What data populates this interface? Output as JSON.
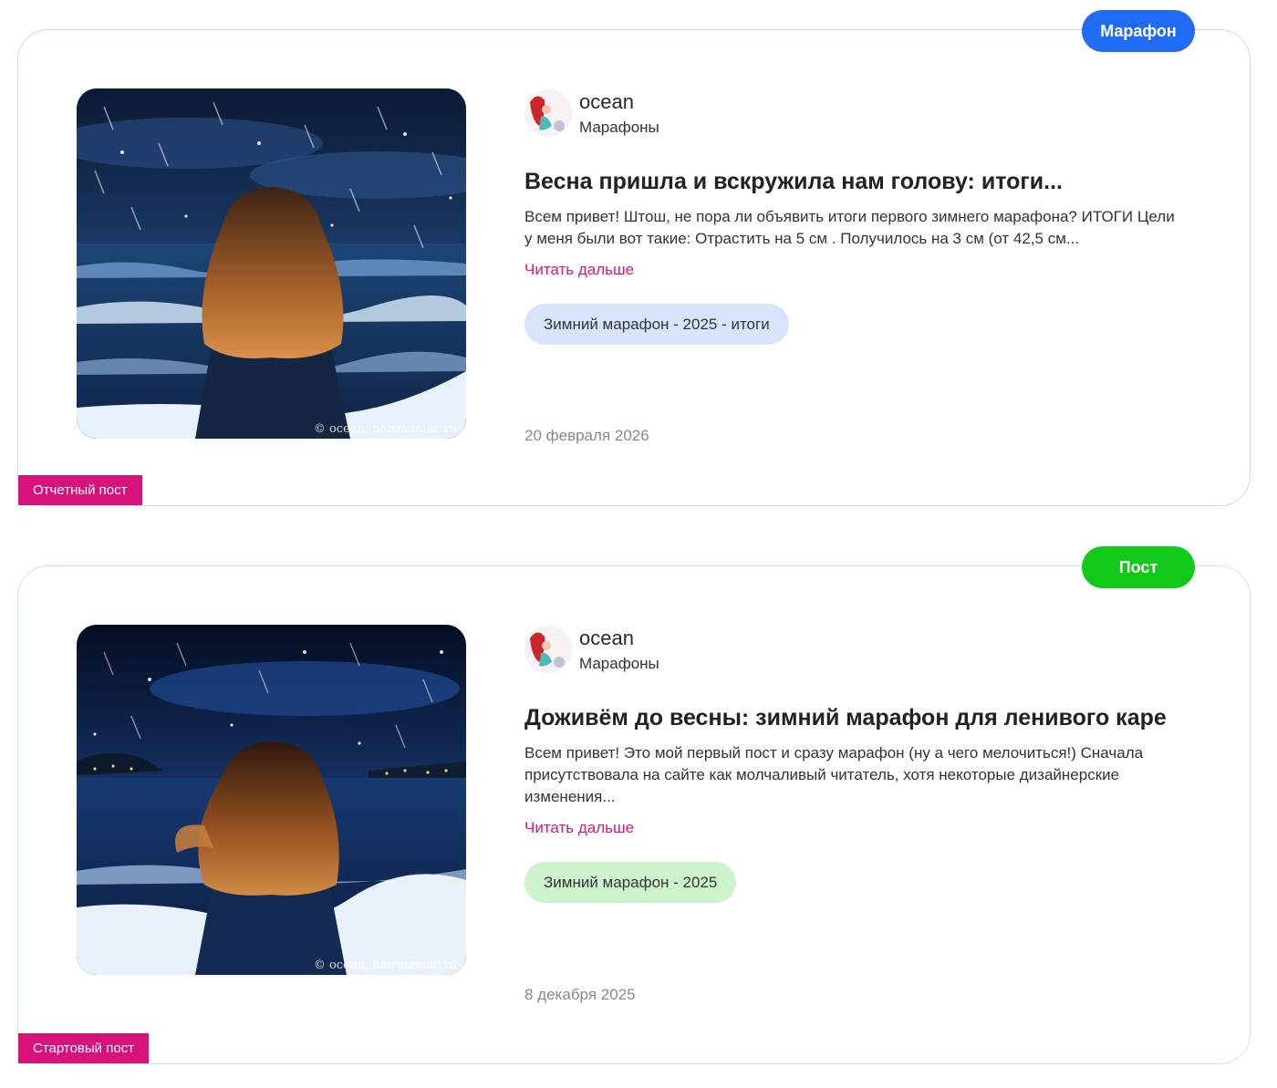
{
  "posts": [
    {
      "type_label": "Марафон",
      "author": "ocean",
      "category": "Марафоны",
      "title": "Весна пришла и вскружила нам голову: итоги...",
      "excerpt": "Всем привет! Штош, не пора ли объявить итоги первого зимнего марафона? ИТОГИ Цели у меня были вот такие: Отрастить на 5 см . Получилось на 3 см (от 42,5 см...",
      "read_more": "Читать дальше",
      "tag": "Зимний марафон - 2025 - итоги",
      "date": "20 февраля 2026",
      "badge": "Отчетный пост",
      "watermark": "© ocean, hairmaniac.ru"
    },
    {
      "type_label": "Пост",
      "author": "ocean",
      "category": "Марафоны",
      "title": "Доживём до весны: зимний марафон для ленивого каре",
      "excerpt": "Всем привет! Это мой первый пост и сразу марафон (ну а чего мелочиться!) Сначала присутствовала на сайте как молчаливый читатель, хотя некоторые дизайнерские изменения...",
      "read_more": "Читать дальше",
      "tag": "Зимний марафон - 2025",
      "date": "8 декабря 2025",
      "badge": "Стартовый пост",
      "watermark": "© ocean, hairmaniac.ru"
    }
  ],
  "colors": {
    "marathon": "#1f6bf3",
    "post": "#12c91a",
    "badge": "#d8127b",
    "read_more": "#d4187f"
  }
}
